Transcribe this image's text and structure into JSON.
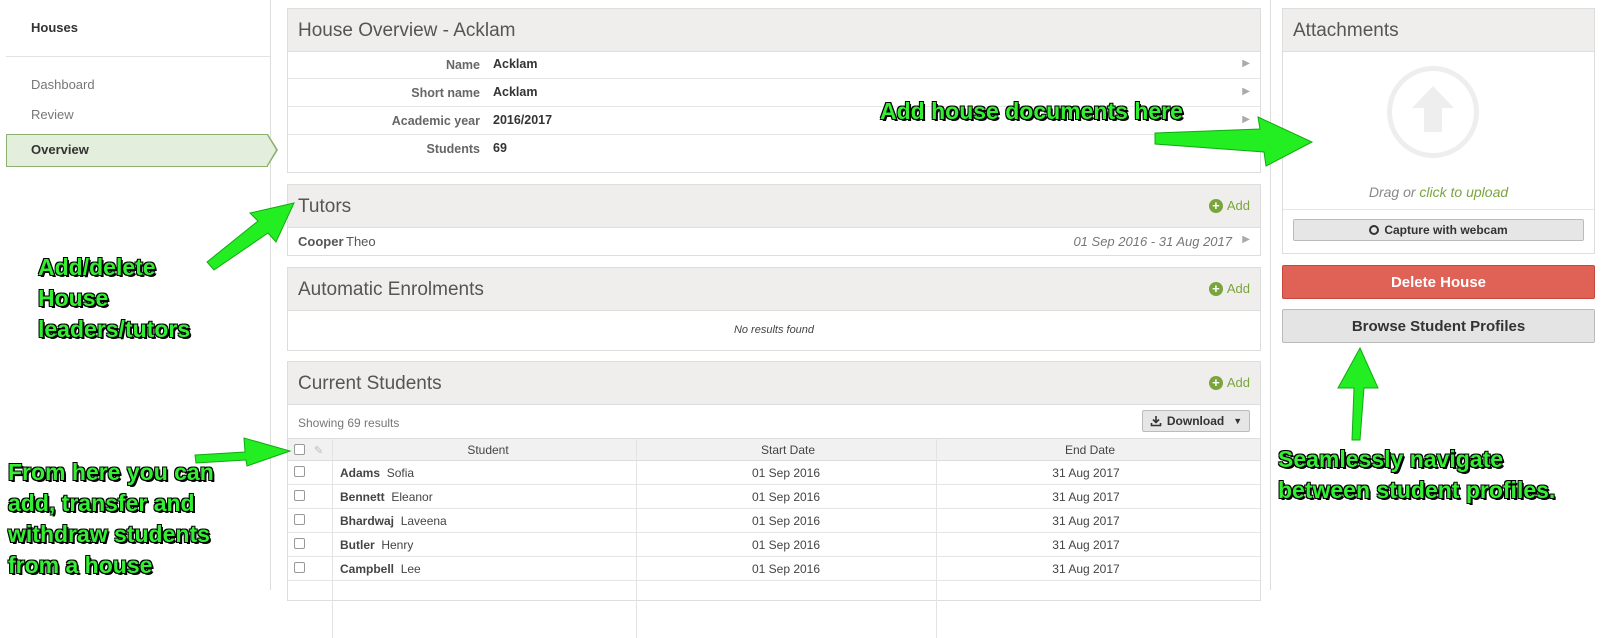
{
  "sidebar": {
    "title": "Houses",
    "items": [
      {
        "label": "Dashboard"
      },
      {
        "label": "Review"
      },
      {
        "label": "Overview"
      }
    ]
  },
  "overview": {
    "title": "House Overview - Acklam",
    "rows": [
      {
        "label": "Name",
        "value": "Acklam"
      },
      {
        "label": "Short name",
        "value": "Acklam"
      },
      {
        "label": "Academic year",
        "value": "2016/2017"
      },
      {
        "label": "Students",
        "value": "69"
      }
    ]
  },
  "tutors": {
    "title": "Tutors",
    "add_label": "Add",
    "items": [
      {
        "last": "Cooper",
        "first": "Theo",
        "dates": "01 Sep 2016 - 31 Aug 2017"
      }
    ]
  },
  "enrolments": {
    "title": "Automatic Enrolments",
    "add_label": "Add",
    "empty_text": "No results found"
  },
  "students": {
    "title": "Current Students",
    "add_label": "Add",
    "showing": "Showing 69 results",
    "download_label": "Download",
    "columns": [
      "Student",
      "Start Date",
      "End Date"
    ],
    "rows": [
      {
        "last": "Adams",
        "first": "Sofia",
        "start": "01 Sep 2016",
        "end": "31 Aug 2017"
      },
      {
        "last": "Bennett",
        "first": "Eleanor",
        "start": "01 Sep 2016",
        "end": "31 Aug 2017"
      },
      {
        "last": "Bhardwaj",
        "first": "Laveena",
        "start": "01 Sep 2016",
        "end": "31 Aug 2017"
      },
      {
        "last": "Butler",
        "first": "Henry",
        "start": "01 Sep 2016",
        "end": "31 Aug 2017"
      },
      {
        "last": "Campbell",
        "first": "Lee",
        "start": "01 Sep 2016",
        "end": "31 Aug 2017"
      }
    ]
  },
  "attachments": {
    "title": "Attachments",
    "drag_text": "Drag or",
    "click_text": "click to upload",
    "webcam_label": "Capture with webcam"
  },
  "actions": {
    "delete_label": "Delete House",
    "browse_label": "Browse Student Profiles"
  },
  "annotations": {
    "docs": "Add house documents here",
    "tutors": [
      "Add/delete",
      "House",
      "leaders/tutors"
    ],
    "students": [
      "From here you can",
      "add, transfer and",
      "withdraw students",
      "from a house"
    ],
    "navigate": [
      "Seamlessly navigate",
      "between student profiles."
    ]
  },
  "colors": {
    "accent_green": "#7aa53d",
    "delete_red": "#e06257",
    "annotation_green": "#33ee33",
    "active_nav": "#e4eedd"
  }
}
